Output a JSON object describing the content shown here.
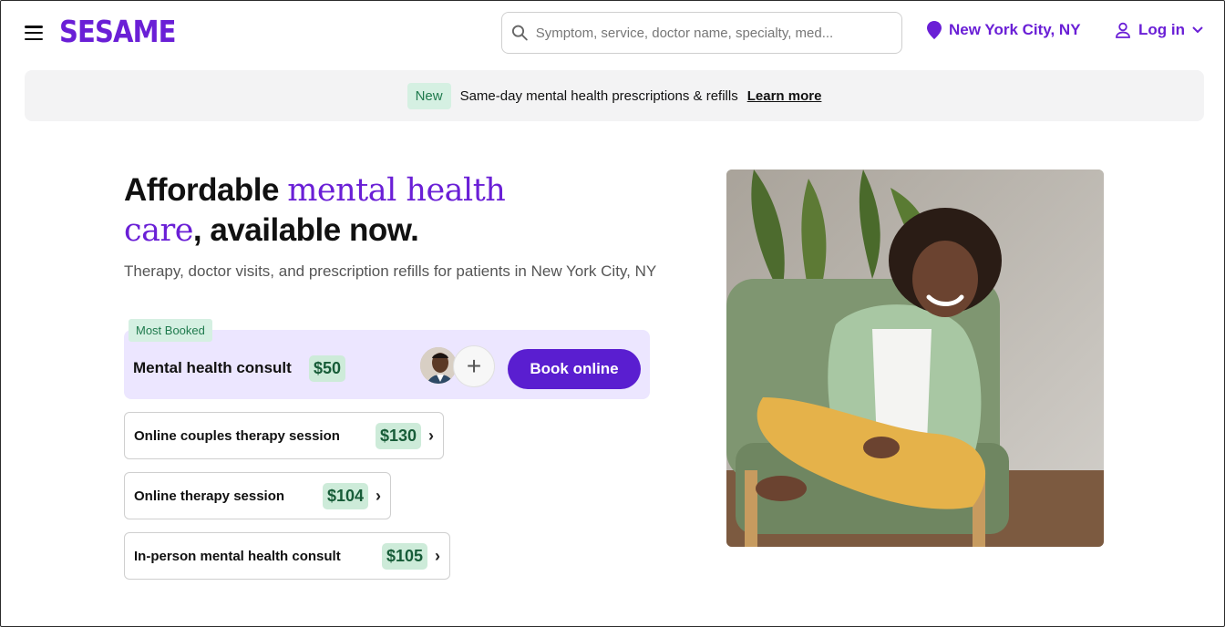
{
  "header": {
    "logo": "SESAME",
    "search_placeholder": "Symptom, service, doctor name, specialty, med...",
    "location": "New York City, NY",
    "login": "Log in"
  },
  "banner": {
    "badge": "New",
    "text": "Same-day mental health prescriptions & refills",
    "link": "Learn more"
  },
  "hero": {
    "title_part1": "Affordable ",
    "title_accent_1": "mental health",
    "title_accent_2": "care",
    "title_part2": ", available now.",
    "subtitle": "Therapy, doctor visits, and prescription refills for patients in New York City, NY"
  },
  "featured": {
    "badge": "Most Booked",
    "name": "Mental health consult",
    "price": "$50",
    "button": "Book online"
  },
  "services": [
    {
      "name": "Online couples therapy session",
      "price": "$130"
    },
    {
      "name": "Online therapy session",
      "price": "$104"
    },
    {
      "name": "In-person mental health consult",
      "price": "$105"
    }
  ],
  "colors": {
    "brand": "#6a1fd6",
    "button": "#5a1ed0",
    "price_bg": "#cdebd9",
    "featured_bg": "#ece6ff"
  }
}
